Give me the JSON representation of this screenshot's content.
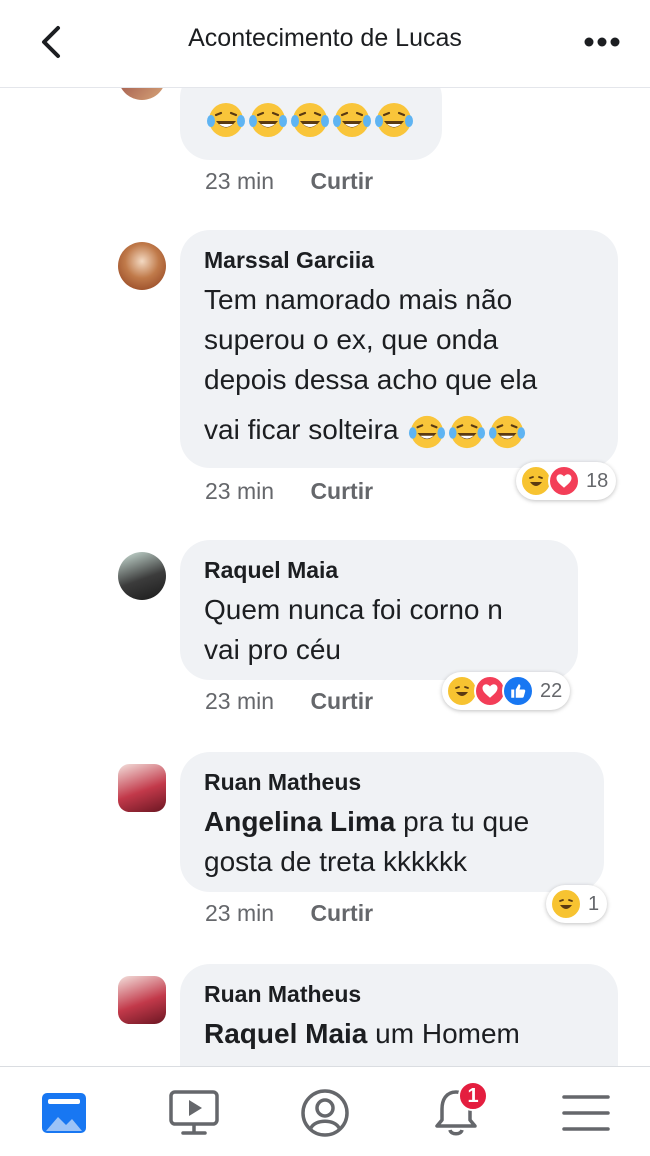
{
  "header": {
    "title": "Acontecimento de Lucas"
  },
  "comments": [
    {
      "author": "",
      "text": "",
      "emoji_count": 5,
      "time": "23 min",
      "like_label": "Curtir"
    },
    {
      "author": "Marssal Garciia",
      "lines": [
        "Tem namorado mais não",
        "superou o ex, que onda",
        "depois dessa acho que ela",
        "vai ficar solteira"
      ],
      "emoji_count": 3,
      "time": "23 min",
      "like_label": "Curtir",
      "reactions": [
        "haha",
        "love"
      ],
      "reaction_count": "18"
    },
    {
      "author": "Raquel Maia",
      "lines": [
        "Quem nunca foi corno n",
        "vai pro céu"
      ],
      "time": "23 min",
      "like_label": "Curtir",
      "reactions": [
        "haha",
        "love",
        "like"
      ],
      "reaction_count": "22"
    },
    {
      "author": "Ruan Matheus",
      "mention": "Angelina Lima",
      "line1_rest": " pra tu que",
      "line2": "gosta de treta kkkkkk",
      "time": "23 min",
      "like_label": "Curtir",
      "reactions": [
        "haha"
      ],
      "reaction_count": "1"
    },
    {
      "author": "Ruan Matheus",
      "mention": "Raquel Maia",
      "line1_rest": " um Homem"
    }
  ],
  "nav": {
    "items": [
      "news-feed",
      "watch",
      "profile",
      "notifications",
      "menu"
    ],
    "notification_badge": "1"
  },
  "colors": {
    "accent": "#1877f2",
    "badge": "#e41e3f",
    "bubble": "#f0f2f5",
    "meta": "#65676b"
  }
}
